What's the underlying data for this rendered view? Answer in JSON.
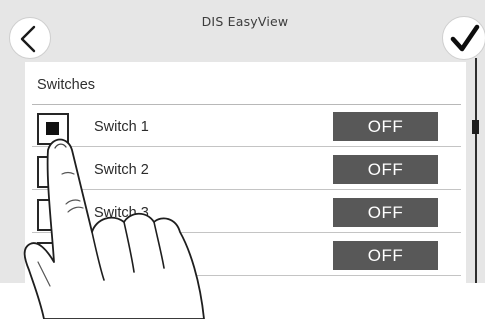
{
  "header": {
    "title": "DIS EasyView",
    "back_icon": "chevron-left-icon",
    "confirm_icon": "checkmark-icon"
  },
  "panel": {
    "title": "Switches",
    "rows": [
      {
        "label": "Switch 1",
        "state": "OFF",
        "checked": true
      },
      {
        "label": "Switch 2",
        "state": "OFF",
        "checked": false
      },
      {
        "label": "Switch 3",
        "state": "OFF",
        "checked": false
      },
      {
        "label": "",
        "state": "OFF",
        "checked": false
      }
    ]
  },
  "colors": {
    "background": "#e6e6e6",
    "panel": "#ffffff",
    "state_button": "#585858",
    "state_text": "#ffffff"
  }
}
